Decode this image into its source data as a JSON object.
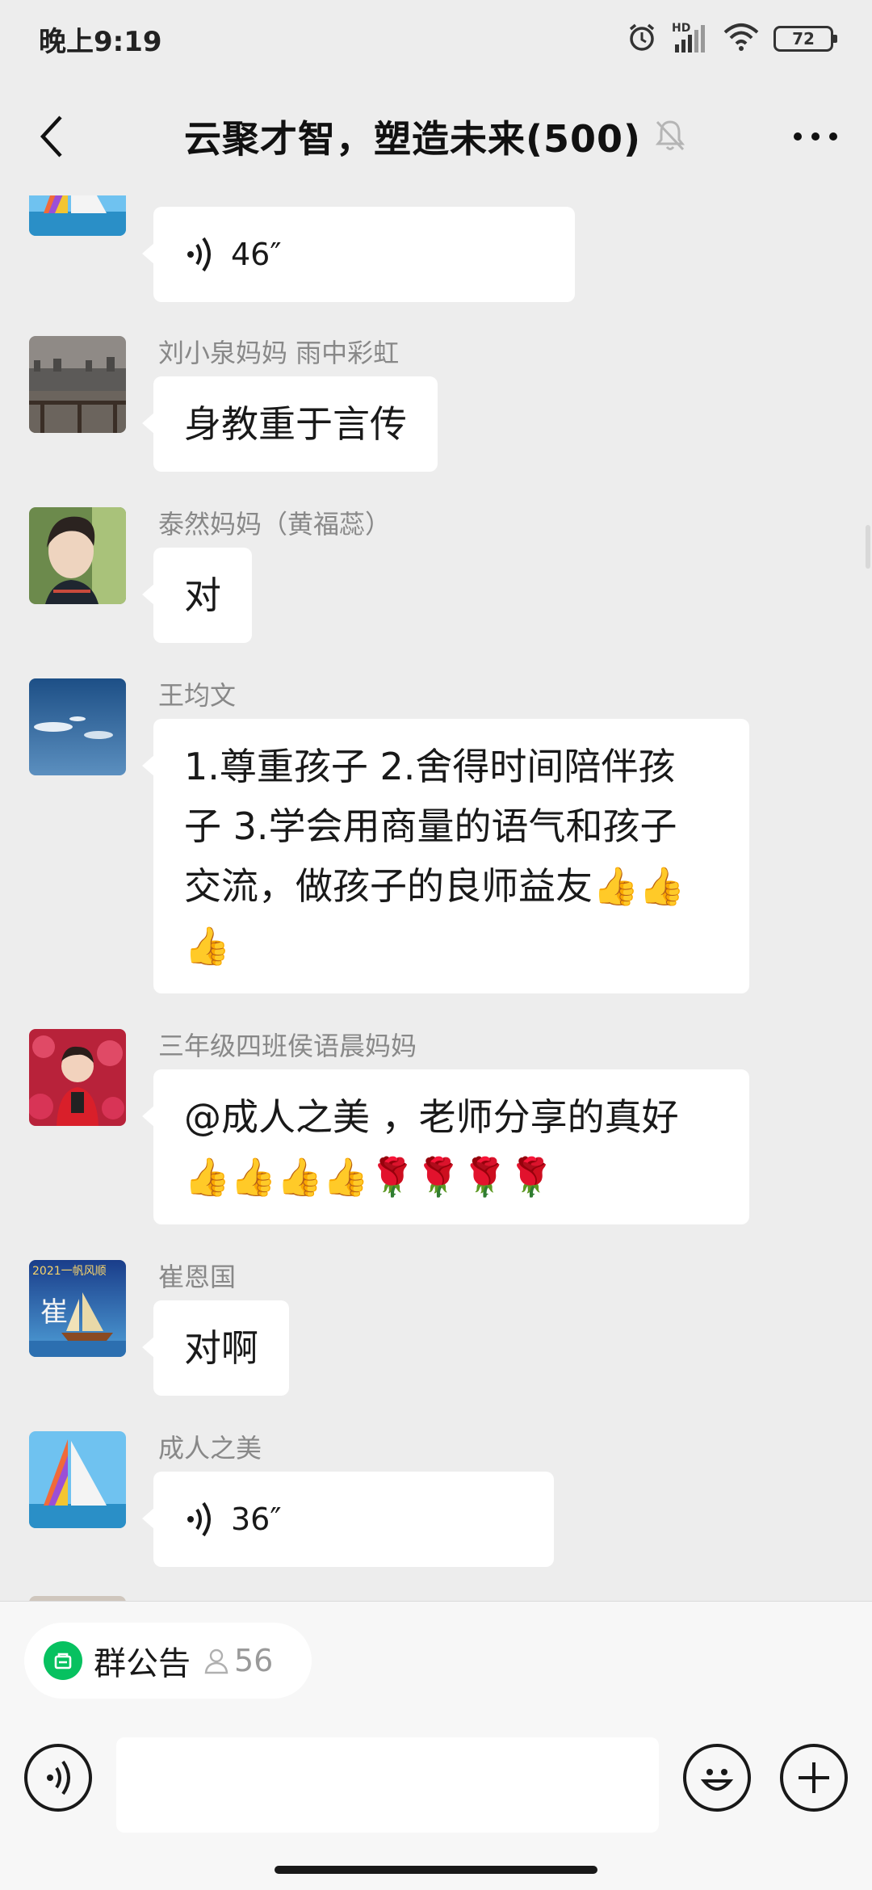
{
  "status_bar": {
    "time": "晚上9:19",
    "signal_label": "HD",
    "battery": "72",
    "icons": [
      "alarm-icon",
      "signal-icon",
      "wifi-icon",
      "battery-icon"
    ]
  },
  "header": {
    "title": "云聚才智，塑造未来(500)",
    "muted": true
  },
  "messages": [
    {
      "sender": "",
      "type": "voice",
      "duration": "46″",
      "avatar": "sailboat"
    },
    {
      "sender": "刘小泉妈妈 雨中彩虹",
      "type": "text",
      "text": "身教重于言传",
      "avatar": "lake"
    },
    {
      "sender": "泰然妈妈（黄福蕊）",
      "type": "text",
      "text": "对",
      "avatar": "portrait"
    },
    {
      "sender": "王均文",
      "type": "text",
      "lines": [
        "1.尊重孩子 2.舍得时间陪伴孩",
        "子 3.学会用商量的语气和孩子",
        "交流，做孩子的良师益友"
      ],
      "avatar": "sky"
    },
    {
      "sender": "三年级四班侯语晨妈妈",
      "type": "text",
      "text": "@成人之美 ，老师分享的真好",
      "avatar": "girl"
    },
    {
      "sender": "崔恩国",
      "type": "text",
      "text": "对啊",
      "avatar": "ship"
    },
    {
      "sender": "成人之美",
      "type": "voice",
      "duration": "36″",
      "avatar": "sailboat"
    }
  ],
  "emoji": {
    "thumbs_up": "👍",
    "rose": "🌹"
  },
  "avatar_art": {
    "ship_caption": "2021一帆风顺",
    "ship_glyph": "崔"
  },
  "notice": {
    "label": "群公告",
    "count": "56"
  },
  "input": {
    "value": "",
    "placeholder": ""
  },
  "colors": {
    "background": "#ededed",
    "bubble": "#ffffff",
    "accent": "#07c160"
  }
}
